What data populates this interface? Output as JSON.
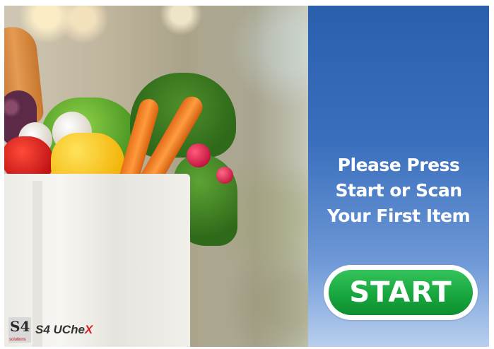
{
  "kiosk": {
    "prompt_lines": [
      "Please Press",
      "Start or Scan",
      "Your First Item"
    ],
    "start_button_label": "START"
  },
  "brand": {
    "logo_mark": "S4",
    "logo_sub": "solutions",
    "name_main": "S4 UChe",
    "name_accent": "X"
  },
  "colors": {
    "panel_blue": "#2a5fae",
    "start_green": "#16a43c",
    "brand_red": "#d41f26"
  }
}
